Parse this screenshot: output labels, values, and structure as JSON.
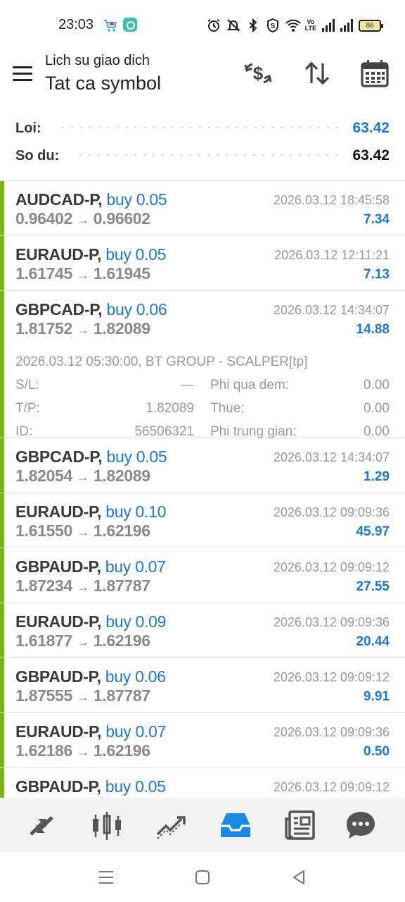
{
  "status_bar": {
    "time": "23:03",
    "lte_label": "Vo\nLTE",
    "battery": "86"
  },
  "header": {
    "subtitle": "Lich su giao dich",
    "title": "Tat ca symbol"
  },
  "summary": {
    "profit_label": "Loi:",
    "profit_value": "63.42",
    "balance_label": "So du:",
    "balance_value": "63.42"
  },
  "colors": {
    "accent_blue": "#1a78d6",
    "profit_bar_green": "#7cb518",
    "nav_active": "#1a8be0"
  },
  "trades": [
    {
      "symbol": "AUDCAD-P,",
      "side": "buy 0.05",
      "open": "0.96402",
      "close": "0.96602",
      "time": "2026.03.12 18:45:58",
      "profit": "7.34"
    },
    {
      "symbol": "EURAUD-P,",
      "side": "buy 0.05",
      "open": "1.61745",
      "close": "1.61945",
      "time": "2026.03.12 12:11:21",
      "profit": "7.13"
    },
    {
      "symbol": "GBPCAD-P,",
      "side": "buy 0.06",
      "open": "1.81752",
      "close": "1.82089",
      "time": "2026.03.12 14:34:07",
      "profit": "14.88",
      "detail": {
        "comment": "2026.03.12 05:30:00, BT GROUP - SCALPER[tp]",
        "sl_label": "S/L:",
        "sl_value": "—",
        "tp_label": "T/P:",
        "tp_value": "1.82089",
        "id_label": "ID:",
        "id_value": "56506321",
        "swap_label": "Phi qua dem:",
        "swap_value": "0.00",
        "tax_label": "Thue:",
        "tax_value": "0.00",
        "fee_label": "Phi trung gian:",
        "fee_value": "0.00"
      }
    },
    {
      "symbol": "GBPCAD-P,",
      "side": "buy 0.05",
      "open": "1.82054",
      "close": "1.82089",
      "time": "2026.03.12 14:34:07",
      "profit": "1.29"
    },
    {
      "symbol": "EURAUD-P,",
      "side": "buy 0.10",
      "open": "1.61550",
      "close": "1.62196",
      "time": "2026.03.12 09:09:36",
      "profit": "45.97"
    },
    {
      "symbol": "GBPAUD-P,",
      "side": "buy 0.07",
      "open": "1.87234",
      "close": "1.87787",
      "time": "2026.03.12 09:09:12",
      "profit": "27.55"
    },
    {
      "symbol": "EURAUD-P,",
      "side": "buy 0.09",
      "open": "1.61877",
      "close": "1.62196",
      "time": "2026.03.12 09:09:36",
      "profit": "20.44"
    },
    {
      "symbol": "GBPAUD-P,",
      "side": "buy 0.06",
      "open": "1.87555",
      "close": "1.87787",
      "time": "2026.03.12 09:09:12",
      "profit": "9.91"
    },
    {
      "symbol": "EURAUD-P,",
      "side": "buy 0.07",
      "open": "1.62186",
      "close": "1.62196",
      "time": "2026.03.12 09:09:36",
      "profit": "0.50"
    },
    {
      "symbol": "GBPAUD-P,",
      "side": "buy 0.05",
      "open": "",
      "close": "",
      "time": "2026.03.12 09:09:12",
      "profit": ""
    }
  ],
  "arrow_glyph": "→",
  "bottom_nav": [
    {
      "icon": "trade-arrows-icon",
      "active": false
    },
    {
      "icon": "candlestick-chart-icon",
      "active": false
    },
    {
      "icon": "trend-lines-icon",
      "active": false
    },
    {
      "icon": "history-inbox-icon",
      "active": true
    },
    {
      "icon": "news-icon",
      "active": false
    },
    {
      "icon": "chat-bubble-icon",
      "active": false
    }
  ]
}
